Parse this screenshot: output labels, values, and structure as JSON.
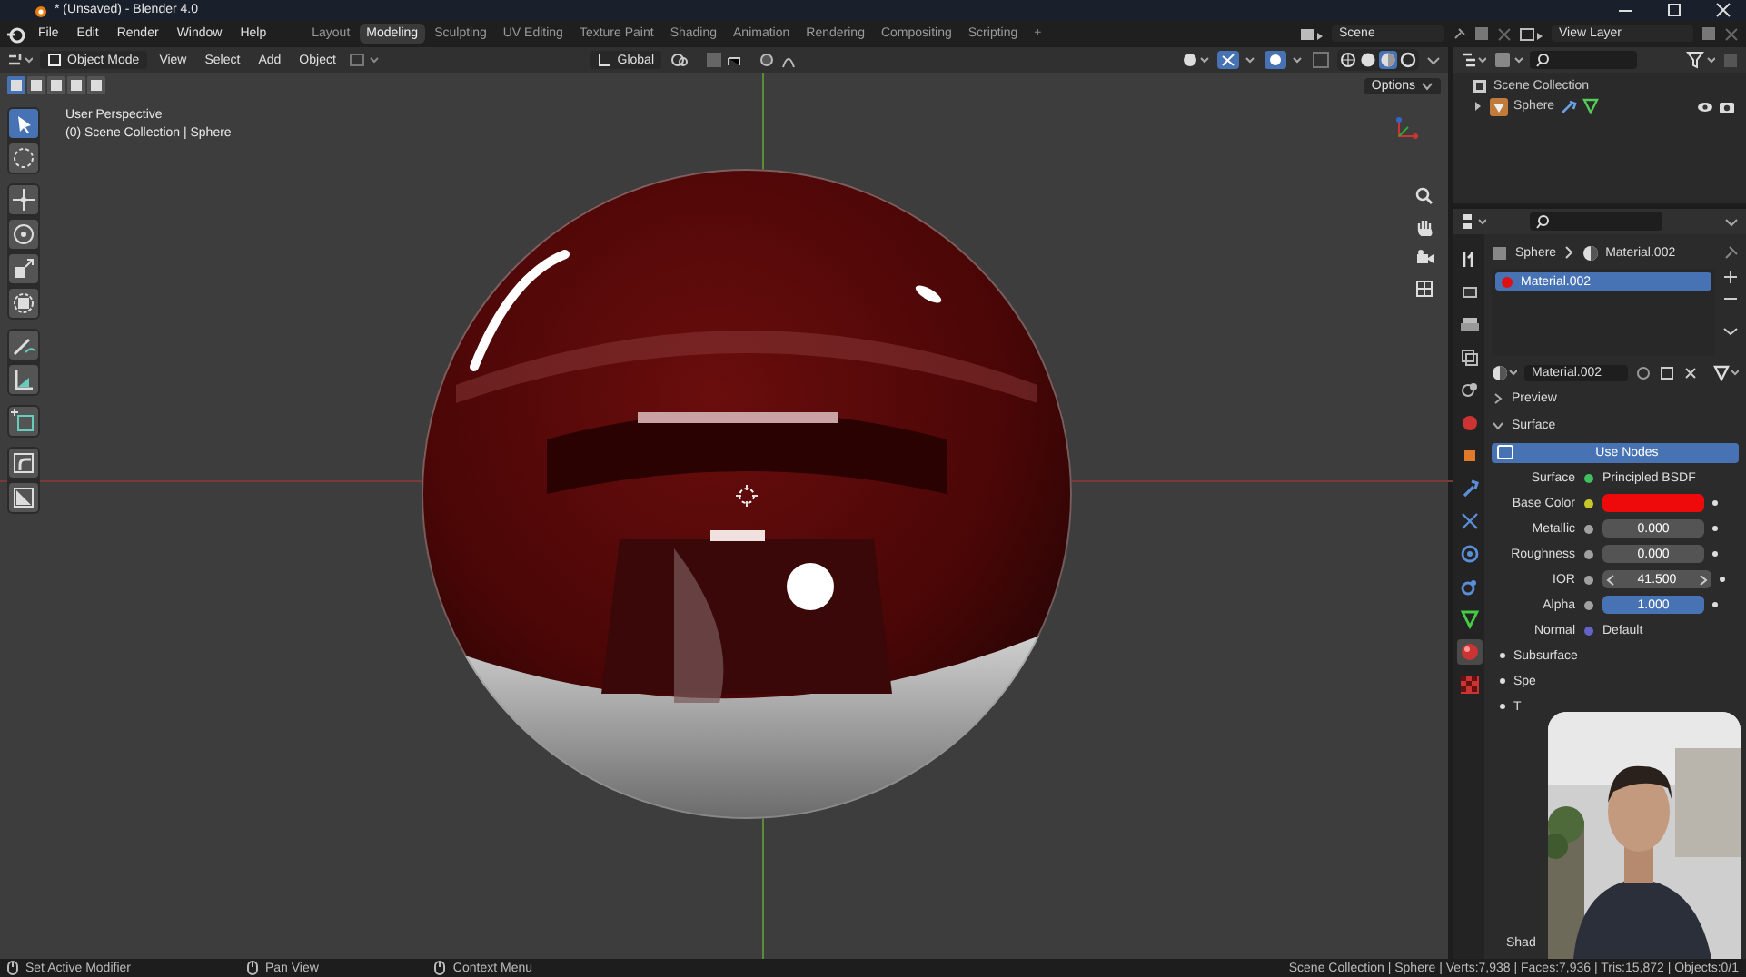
{
  "window": {
    "title": "* (Unsaved) - Blender 4.0"
  },
  "menu": [
    "File",
    "Edit",
    "Render",
    "Window",
    "Help"
  ],
  "workspace_tabs": [
    {
      "label": "Layout",
      "selected": false
    },
    {
      "label": "Modeling",
      "selected": true
    },
    {
      "label": "Sculpting",
      "selected": false
    },
    {
      "label": "UV Editing",
      "selected": false
    },
    {
      "label": "Texture Paint",
      "selected": false
    },
    {
      "label": "Shading",
      "selected": false
    },
    {
      "label": "Animation",
      "selected": false
    },
    {
      "label": "Rendering",
      "selected": false
    },
    {
      "label": "Compositing",
      "selected": false
    },
    {
      "label": "Scripting",
      "selected": false
    }
  ],
  "add_workspace": "+",
  "scene": "Scene",
  "view_layer": "View Layer",
  "viewport_header": {
    "mode": "Object Mode",
    "menus": [
      "View",
      "Select",
      "Add",
      "Object"
    ],
    "orientation": "Global",
    "options": "Options"
  },
  "select_modes": [
    {
      "selected": true
    },
    {
      "selected": false
    },
    {
      "selected": false
    },
    {
      "selected": false
    },
    {
      "selected": false
    }
  ],
  "shading_modes": [
    {
      "kind": "wireframe",
      "selected": false
    },
    {
      "kind": "solid",
      "selected": false
    },
    {
      "kind": "material",
      "selected": true
    },
    {
      "kind": "rendered",
      "selected": false
    }
  ],
  "viewport": {
    "overlay": [
      "User Perspective",
      "(0) Scene Collection | Sphere"
    ]
  },
  "tool_groups": [
    [
      {
        "kind": "select",
        "selected": true
      },
      {
        "kind": "select_circle",
        "selected": false
      }
    ],
    [
      {
        "kind": "move",
        "selected": false
      },
      {
        "kind": "rotate",
        "selected": false
      },
      {
        "kind": "scale",
        "selected": false
      },
      {
        "kind": "transform",
        "selected": false
      }
    ],
    [
      {
        "kind": "annotate",
        "selected": false
      },
      {
        "kind": "measure",
        "selected": false
      }
    ],
    [
      {
        "kind": "add_cube",
        "selected": false
      }
    ],
    [
      {
        "kind": "bevel",
        "selected": false
      },
      {
        "kind": "inset",
        "selected": false
      }
    ]
  ],
  "outliner": {
    "root": "Scene Collection",
    "children": [
      {
        "label": "Sphere",
        "expanded": false
      }
    ]
  },
  "properties": {
    "tabs": [
      {
        "kind": "tool",
        "selected": false
      },
      {
        "kind": "render",
        "selected": false
      },
      {
        "kind": "output",
        "selected": false
      },
      {
        "kind": "view_layer",
        "selected": false
      },
      {
        "kind": "scene",
        "selected": false
      },
      {
        "kind": "world",
        "selected": false
      },
      {
        "kind": "object",
        "selected": false
      },
      {
        "kind": "modifiers",
        "selected": false
      },
      {
        "kind": "particles",
        "selected": false
      },
      {
        "kind": "physics",
        "selected": false
      },
      {
        "kind": "constraints",
        "selected": false
      },
      {
        "kind": "data",
        "selected": false
      },
      {
        "kind": "material",
        "selected": true
      },
      {
        "kind": "texture",
        "selected": false
      }
    ],
    "breadcrumb": [
      "Sphere",
      "Material.002"
    ],
    "slots": [
      {
        "label": "Material.002",
        "selected": true
      }
    ],
    "material_name": "Material.002",
    "panels": [
      {
        "label": "Preview",
        "expanded": false
      },
      {
        "label": "Surface",
        "expanded": true
      }
    ],
    "use_nodes": "Use Nodes",
    "fields": [
      {
        "kind": "link",
        "label": "Surface",
        "socket": {
          "color": "#3fbf5f"
        },
        "value": "Principled BSDF"
      },
      {
        "kind": "color",
        "label": "Base Color",
        "socket": {
          "color": "#c7c729"
        },
        "color": "#ee0a0a"
      },
      {
        "kind": "slider",
        "label": "Metallic",
        "socket": {
          "color": "#a1a1a1"
        },
        "value": "0.000",
        "level": 0
      },
      {
        "kind": "slider",
        "label": "Roughness",
        "socket": {
          "color": "#a1a1a1"
        },
        "value": "0.000",
        "level": 0
      },
      {
        "kind": "number",
        "label": "IOR",
        "socket": {
          "color": "#a1a1a1"
        },
        "value": "41.500"
      },
      {
        "kind": "slider",
        "label": "Alpha",
        "socket": {
          "color": "#a1a1a1"
        },
        "value": "1.000",
        "level": 1
      },
      {
        "kind": "link",
        "label": "Normal",
        "socket": {
          "color": "#6363c7"
        },
        "value": "Default"
      }
    ],
    "subpanels": [
      "Subsurface",
      "Spe",
      "T"
    ],
    "bottom_panel": "Shad"
  },
  "status_bar": {
    "hints": [
      "Set Active Modifier",
      "Pan View",
      "Context Menu"
    ],
    "stats": "Scene Collection | Sphere | Verts:7,938 | Faces:7,936 | Tris:15,872 | Objects:0/1"
  }
}
